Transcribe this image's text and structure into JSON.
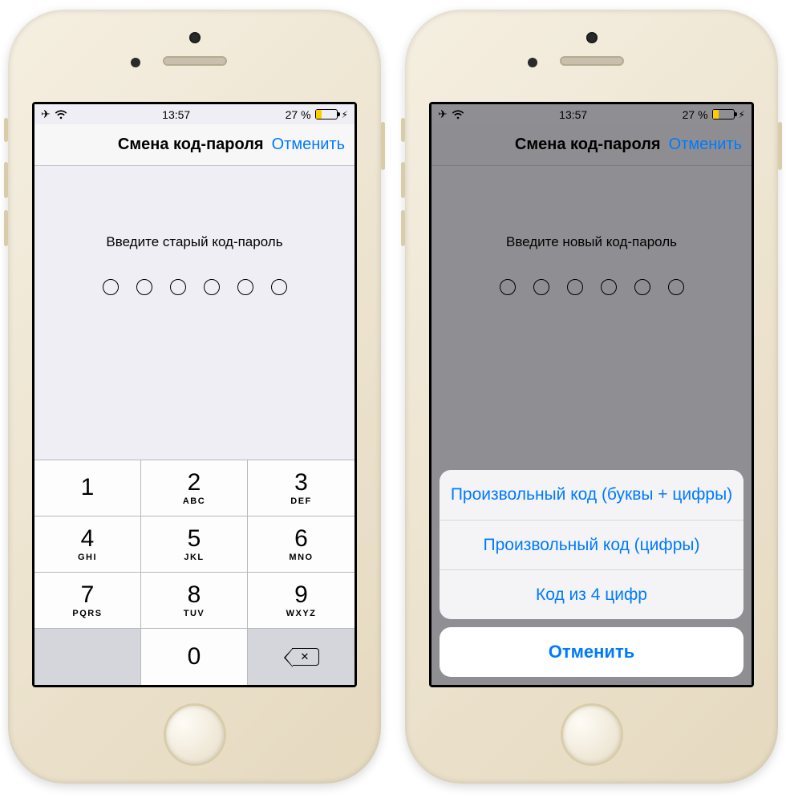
{
  "status": {
    "time": "13:57",
    "battery_pct": "27 %",
    "battery_fill_css": "27%"
  },
  "nav": {
    "title": "Смена код-пароля",
    "cancel": "Отменить"
  },
  "left": {
    "prompt": "Введите старый код-пароль"
  },
  "right": {
    "prompt": "Введите новый код-пароль"
  },
  "keypad": {
    "k1": {
      "num": "1",
      "letters": ""
    },
    "k2": {
      "num": "2",
      "letters": "ABC"
    },
    "k3": {
      "num": "3",
      "letters": "DEF"
    },
    "k4": {
      "num": "4",
      "letters": "GHI"
    },
    "k5": {
      "num": "5",
      "letters": "JKL"
    },
    "k6": {
      "num": "6",
      "letters": "MNO"
    },
    "k7": {
      "num": "7",
      "letters": "PQRS"
    },
    "k8": {
      "num": "8",
      "letters": "TUV"
    },
    "k9": {
      "num": "9",
      "letters": "WXYZ"
    },
    "k0": {
      "num": "0",
      "letters": ""
    }
  },
  "sheet": {
    "opt1": "Произвольный код (буквы + цифры)",
    "opt2": "Произвольный код (цифры)",
    "opt3": "Код из 4 цифр",
    "cancel": "Отменить"
  }
}
